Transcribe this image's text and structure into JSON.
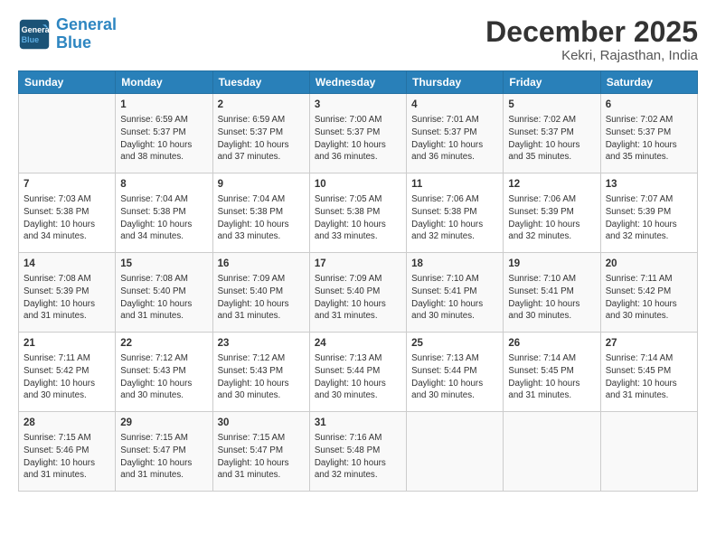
{
  "logo": {
    "line1": "General",
    "line2": "Blue"
  },
  "title": "December 2025",
  "subtitle": "Kekri, Rajasthan, India",
  "headers": [
    "Sunday",
    "Monday",
    "Tuesday",
    "Wednesday",
    "Thursday",
    "Friday",
    "Saturday"
  ],
  "rows": [
    [
      {
        "day": "",
        "info": ""
      },
      {
        "day": "1",
        "info": "Sunrise: 6:59 AM\nSunset: 5:37 PM\nDaylight: 10 hours\nand 38 minutes."
      },
      {
        "day": "2",
        "info": "Sunrise: 6:59 AM\nSunset: 5:37 PM\nDaylight: 10 hours\nand 37 minutes."
      },
      {
        "day": "3",
        "info": "Sunrise: 7:00 AM\nSunset: 5:37 PM\nDaylight: 10 hours\nand 36 minutes."
      },
      {
        "day": "4",
        "info": "Sunrise: 7:01 AM\nSunset: 5:37 PM\nDaylight: 10 hours\nand 36 minutes."
      },
      {
        "day": "5",
        "info": "Sunrise: 7:02 AM\nSunset: 5:37 PM\nDaylight: 10 hours\nand 35 minutes."
      },
      {
        "day": "6",
        "info": "Sunrise: 7:02 AM\nSunset: 5:37 PM\nDaylight: 10 hours\nand 35 minutes."
      }
    ],
    [
      {
        "day": "7",
        "info": "Sunrise: 7:03 AM\nSunset: 5:38 PM\nDaylight: 10 hours\nand 34 minutes."
      },
      {
        "day": "8",
        "info": "Sunrise: 7:04 AM\nSunset: 5:38 PM\nDaylight: 10 hours\nand 34 minutes."
      },
      {
        "day": "9",
        "info": "Sunrise: 7:04 AM\nSunset: 5:38 PM\nDaylight: 10 hours\nand 33 minutes."
      },
      {
        "day": "10",
        "info": "Sunrise: 7:05 AM\nSunset: 5:38 PM\nDaylight: 10 hours\nand 33 minutes."
      },
      {
        "day": "11",
        "info": "Sunrise: 7:06 AM\nSunset: 5:38 PM\nDaylight: 10 hours\nand 32 minutes."
      },
      {
        "day": "12",
        "info": "Sunrise: 7:06 AM\nSunset: 5:39 PM\nDaylight: 10 hours\nand 32 minutes."
      },
      {
        "day": "13",
        "info": "Sunrise: 7:07 AM\nSunset: 5:39 PM\nDaylight: 10 hours\nand 32 minutes."
      }
    ],
    [
      {
        "day": "14",
        "info": "Sunrise: 7:08 AM\nSunset: 5:39 PM\nDaylight: 10 hours\nand 31 minutes."
      },
      {
        "day": "15",
        "info": "Sunrise: 7:08 AM\nSunset: 5:40 PM\nDaylight: 10 hours\nand 31 minutes."
      },
      {
        "day": "16",
        "info": "Sunrise: 7:09 AM\nSunset: 5:40 PM\nDaylight: 10 hours\nand 31 minutes."
      },
      {
        "day": "17",
        "info": "Sunrise: 7:09 AM\nSunset: 5:40 PM\nDaylight: 10 hours\nand 31 minutes."
      },
      {
        "day": "18",
        "info": "Sunrise: 7:10 AM\nSunset: 5:41 PM\nDaylight: 10 hours\nand 30 minutes."
      },
      {
        "day": "19",
        "info": "Sunrise: 7:10 AM\nSunset: 5:41 PM\nDaylight: 10 hours\nand 30 minutes."
      },
      {
        "day": "20",
        "info": "Sunrise: 7:11 AM\nSunset: 5:42 PM\nDaylight: 10 hours\nand 30 minutes."
      }
    ],
    [
      {
        "day": "21",
        "info": "Sunrise: 7:11 AM\nSunset: 5:42 PM\nDaylight: 10 hours\nand 30 minutes."
      },
      {
        "day": "22",
        "info": "Sunrise: 7:12 AM\nSunset: 5:43 PM\nDaylight: 10 hours\nand 30 minutes."
      },
      {
        "day": "23",
        "info": "Sunrise: 7:12 AM\nSunset: 5:43 PM\nDaylight: 10 hours\nand 30 minutes."
      },
      {
        "day": "24",
        "info": "Sunrise: 7:13 AM\nSunset: 5:44 PM\nDaylight: 10 hours\nand 30 minutes."
      },
      {
        "day": "25",
        "info": "Sunrise: 7:13 AM\nSunset: 5:44 PM\nDaylight: 10 hours\nand 30 minutes."
      },
      {
        "day": "26",
        "info": "Sunrise: 7:14 AM\nSunset: 5:45 PM\nDaylight: 10 hours\nand 31 minutes."
      },
      {
        "day": "27",
        "info": "Sunrise: 7:14 AM\nSunset: 5:45 PM\nDaylight: 10 hours\nand 31 minutes."
      }
    ],
    [
      {
        "day": "28",
        "info": "Sunrise: 7:15 AM\nSunset: 5:46 PM\nDaylight: 10 hours\nand 31 minutes."
      },
      {
        "day": "29",
        "info": "Sunrise: 7:15 AM\nSunset: 5:47 PM\nDaylight: 10 hours\nand 31 minutes."
      },
      {
        "day": "30",
        "info": "Sunrise: 7:15 AM\nSunset: 5:47 PM\nDaylight: 10 hours\nand 31 minutes."
      },
      {
        "day": "31",
        "info": "Sunrise: 7:16 AM\nSunset: 5:48 PM\nDaylight: 10 hours\nand 32 minutes."
      },
      {
        "day": "",
        "info": ""
      },
      {
        "day": "",
        "info": ""
      },
      {
        "day": "",
        "info": ""
      }
    ]
  ]
}
